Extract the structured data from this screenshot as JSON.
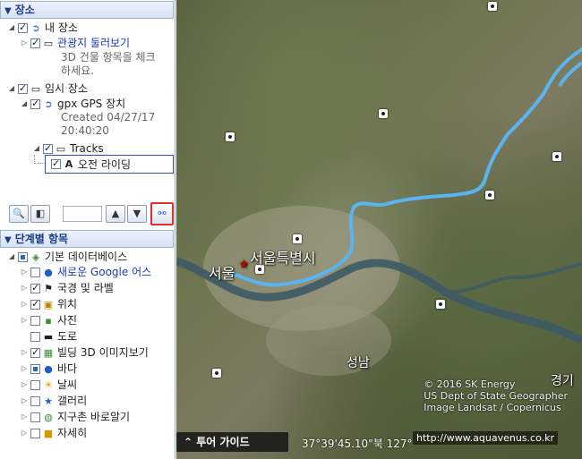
{
  "places_header": "장소",
  "places": {
    "my_places": "내 장소",
    "tour": "관광지 둘러보기",
    "tour_desc_1": "3D 건물 항목을 체크",
    "tour_desc_2": "하세요.",
    "temp_places": "임시 장소",
    "gpx": "gpx GPS 장치",
    "created_1": "Created 04/27/17",
    "created_2": "20:40:20",
    "tracks": "Tracks",
    "track_item": "오전 라이딩"
  },
  "layers_header": "단계별 항목",
  "layers": {
    "primary": "기본 데이터베이스",
    "items": [
      {
        "label": "새로운 Google 어스",
        "link": true
      },
      {
        "label": "국경 및 라벨"
      },
      {
        "label": "위치"
      },
      {
        "label": "사진"
      },
      {
        "label": "도로"
      },
      {
        "label": "빌딩 3D 이미지보기"
      },
      {
        "label": "바다"
      },
      {
        "label": "날씨"
      },
      {
        "label": "갤러리"
      },
      {
        "label": "지구촌 바로알기"
      },
      {
        "label": "자세히"
      }
    ]
  },
  "map": {
    "label_seoul_city": "서울특별시",
    "label_seoul": "서울",
    "label_seongnam": "성남",
    "label_gyeong": "경기",
    "tour_guide": "투어 가이드",
    "coordinates": "37°39'45.10\"북  127°",
    "watermark": "http://www.aquavenus.co.kr",
    "credit_1": "© 2016 SK Energy",
    "credit_2": "US Dept of State Geographer",
    "credit_3": "Image Landsat / Copernicus"
  },
  "colors": {
    "track": "#5ab4f0",
    "header_text": "#1b3b8a",
    "link": "#1a3bbf"
  }
}
